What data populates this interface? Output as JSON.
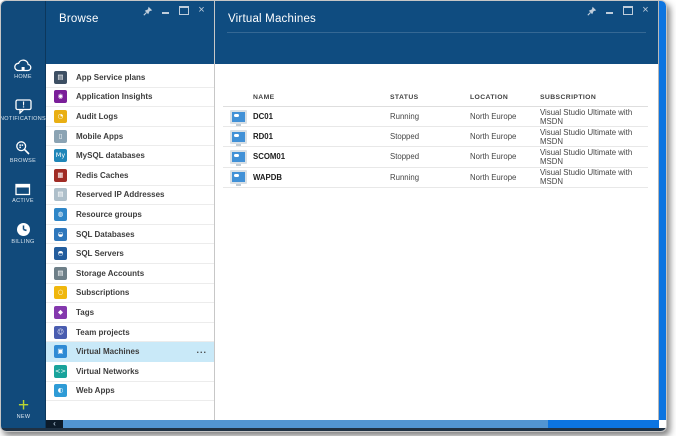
{
  "colors": {
    "portal_background_blue": "#0c74e0",
    "sidebar_navy": "#114a7b",
    "blade_header_navy": "#0f4c80",
    "selected_row_blue": "#c9e9f8",
    "scrollbar_thumb_blue": "#5295d2",
    "new_plus_green": "#b8d432"
  },
  "window_controls": [
    "pin-icon",
    "minimize-icon",
    "maximize-icon",
    "close-icon"
  ],
  "sidebar": {
    "items": [
      {
        "label": "HOME",
        "icon": "home-cloud-icon"
      },
      {
        "label": "NOTIFICATIONS",
        "icon": "notifications-bubble-icon"
      },
      {
        "label": "BROWSE",
        "icon": "browse-magnifier-icon"
      },
      {
        "label": "ACTIVE",
        "icon": "active-window-icon"
      },
      {
        "label": "BILLING",
        "icon": "billing-clock-icon"
      }
    ],
    "new_button": {
      "label": "NEW",
      "icon": "plus-icon"
    }
  },
  "browse_blade": {
    "title": "Browse",
    "items": [
      {
        "label": "App Service plans",
        "icon": "app-service-plans-icon",
        "glyph": "▤",
        "color": "#3d4f63"
      },
      {
        "label": "Application Insights",
        "icon": "application-insights-icon",
        "glyph": "◉",
        "color": "#7a1e99"
      },
      {
        "label": "Audit Logs",
        "icon": "audit-logs-icon",
        "glyph": "◔",
        "color": "#e9af13"
      },
      {
        "label": "Mobile Apps",
        "icon": "mobile-apps-icon",
        "glyph": "▯",
        "color": "#8ba3b3"
      },
      {
        "label": "MySQL databases",
        "icon": "mysql-databases-icon",
        "glyph": "My",
        "color": "#1f86b8"
      },
      {
        "label": "Redis Caches",
        "icon": "redis-caches-icon",
        "glyph": "▦",
        "color": "#a02c25"
      },
      {
        "label": "Reserved IP Addresses",
        "icon": "reserved-ip-addresses-icon",
        "glyph": "▤",
        "color": "#aebfca"
      },
      {
        "label": "Resource groups",
        "icon": "resource-groups-icon",
        "glyph": "◍",
        "color": "#2e86c8"
      },
      {
        "label": "SQL Databases",
        "icon": "sql-databases-icon",
        "glyph": "◒",
        "color": "#2e77bc"
      },
      {
        "label": "SQL Servers",
        "icon": "sql-servers-icon",
        "glyph": "◓",
        "color": "#235d9d"
      },
      {
        "label": "Storage Accounts",
        "icon": "storage-accounts-icon",
        "glyph": "▤",
        "color": "#6e7f88"
      },
      {
        "label": "Subscriptions",
        "icon": "subscriptions-key-icon",
        "glyph": "○",
        "color": "#f0b70d"
      },
      {
        "label": "Tags",
        "icon": "tags-icon",
        "glyph": "◆",
        "color": "#8438ad"
      },
      {
        "label": "Team projects",
        "icon": "team-projects-icon",
        "glyph": "☺",
        "color": "#4a5db0"
      },
      {
        "label": "Virtual Machines",
        "icon": "virtual-machines-icon",
        "glyph": "▣",
        "color": "#2f8bd5",
        "row_class": "bitem selected",
        "overflow": "..."
      },
      {
        "label": "Virtual Networks",
        "icon": "virtual-networks-icon",
        "glyph": "<>",
        "color": "#18a39b"
      },
      {
        "label": "Web Apps",
        "icon": "web-apps-icon",
        "glyph": "◐",
        "color": "#2e9bd6"
      }
    ]
  },
  "vm_blade": {
    "title": "Virtual Machines",
    "row_icon": "vm-monitor-icon",
    "table": {
      "columns": [
        "NAME",
        "STATUS",
        "LOCATION",
        "SUBSCRIPTION"
      ],
      "rows": [
        {
          "name": "DC01",
          "status": "Running",
          "location": "North Europe",
          "subscription": "Visual Studio Ultimate with MSDN"
        },
        {
          "name": "RD01",
          "status": "Stopped",
          "location": "North Europe",
          "subscription": "Visual Studio Ultimate with MSDN"
        },
        {
          "name": "SCOM01",
          "status": "Stopped",
          "location": "North Europe",
          "subscription": "Visual Studio Ultimate with MSDN"
        },
        {
          "name": "WAPDB",
          "status": "Running",
          "location": "North Europe",
          "subscription": "Visual Studio Ultimate with MSDN"
        }
      ]
    }
  },
  "scrollbar": {
    "left_arrow": "‹"
  }
}
